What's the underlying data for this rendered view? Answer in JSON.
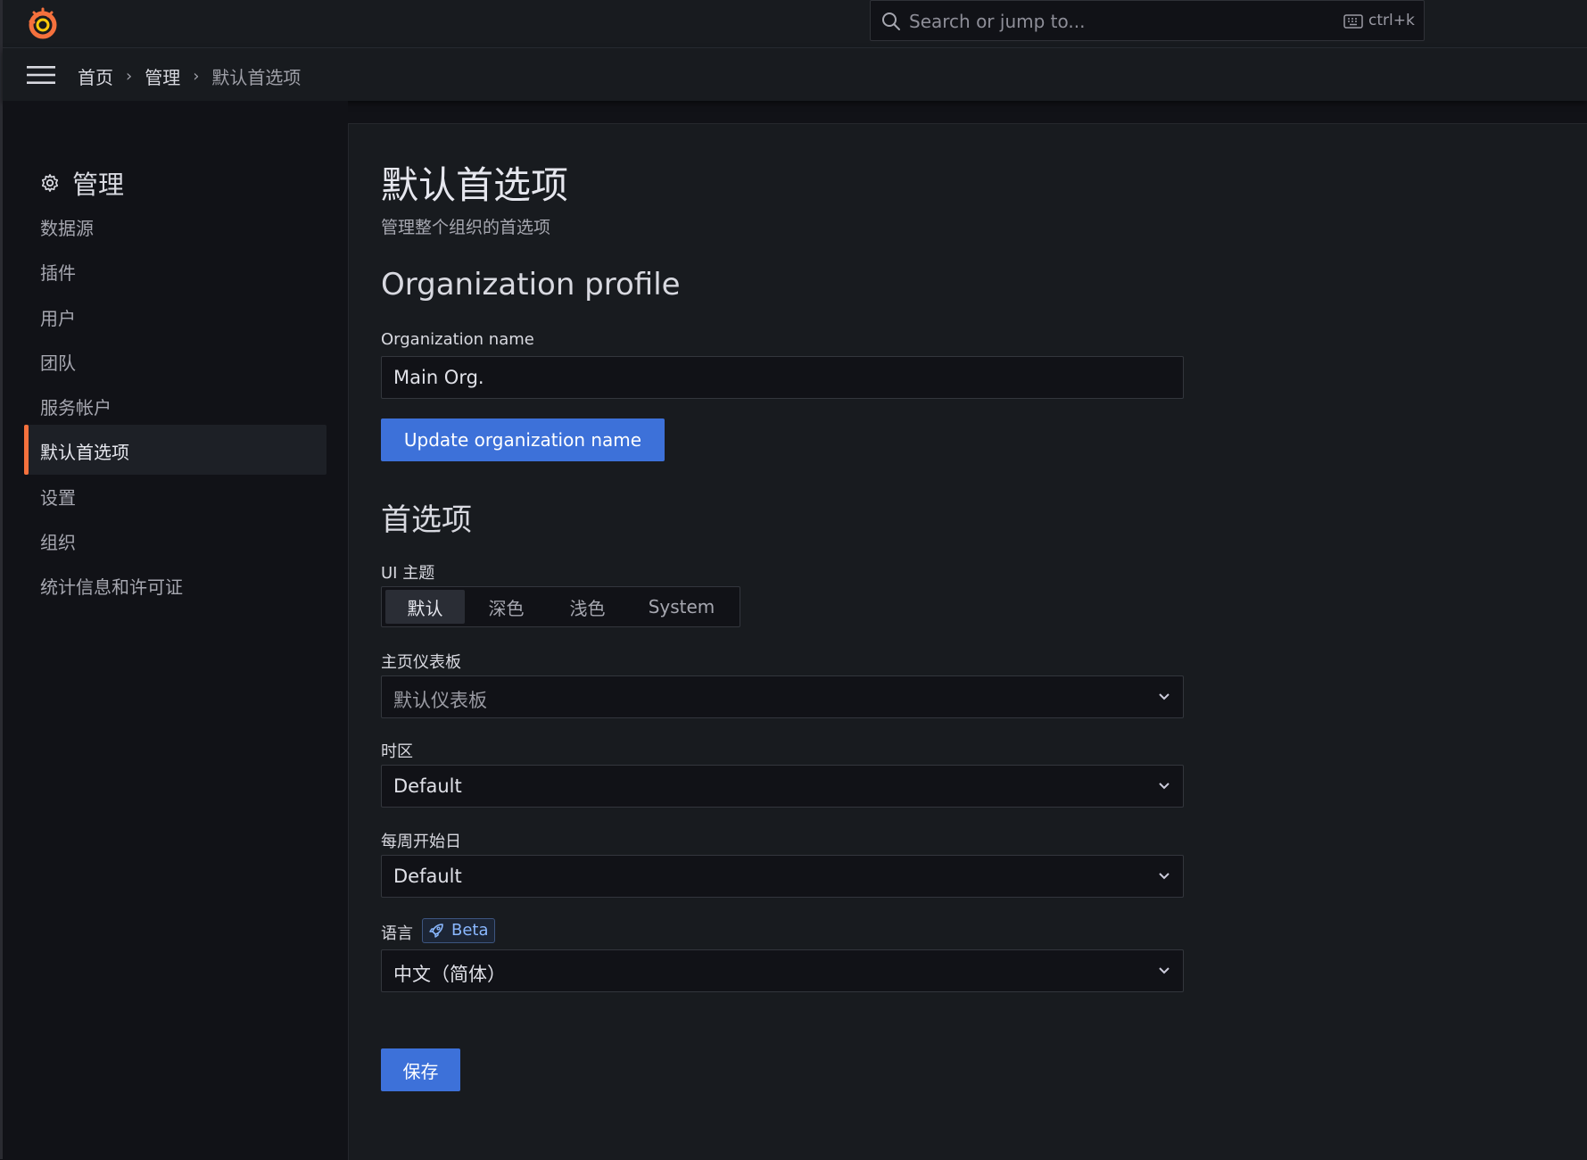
{
  "search": {
    "placeholder": "Search or jump to...",
    "shortcut": "ctrl+k"
  },
  "breadcrumb": [
    "首页",
    "管理",
    "默认首选项"
  ],
  "sidebar": {
    "title": "管理",
    "items": [
      {
        "label": "数据源"
      },
      {
        "label": "插件"
      },
      {
        "label": "用户"
      },
      {
        "label": "团队"
      },
      {
        "label": "服务帐户"
      },
      {
        "label": "默认首选项",
        "active": true
      },
      {
        "label": "设置"
      },
      {
        "label": "组织"
      },
      {
        "label": "统计信息和许可证"
      }
    ]
  },
  "page": {
    "title": "默认首选项",
    "subtitle": "管理整个组织的首选项"
  },
  "org_profile": {
    "heading": "Organization profile",
    "name_label": "Organization name",
    "name_value": "Main Org.",
    "update_button": "Update organization name"
  },
  "preferences": {
    "heading": "首选项",
    "theme_label": "UI 主题",
    "theme_options": [
      "默认",
      "深色",
      "浅色",
      "System"
    ],
    "theme_selected": "默认",
    "home_dashboard_label": "主页仪表板",
    "home_dashboard_placeholder": "默认仪表板",
    "timezone_label": "时区",
    "timezone_value": "Default",
    "week_start_label": "每周开始日",
    "week_start_value": "Default",
    "language_label": "语言",
    "beta_badge": "Beta",
    "language_value": "中文（简体）",
    "save_button": "保存"
  },
  "colors": {
    "accent": "#3d71d9",
    "active_bar": "#f5713d",
    "background": "#111217",
    "panel": "#181b1f"
  }
}
